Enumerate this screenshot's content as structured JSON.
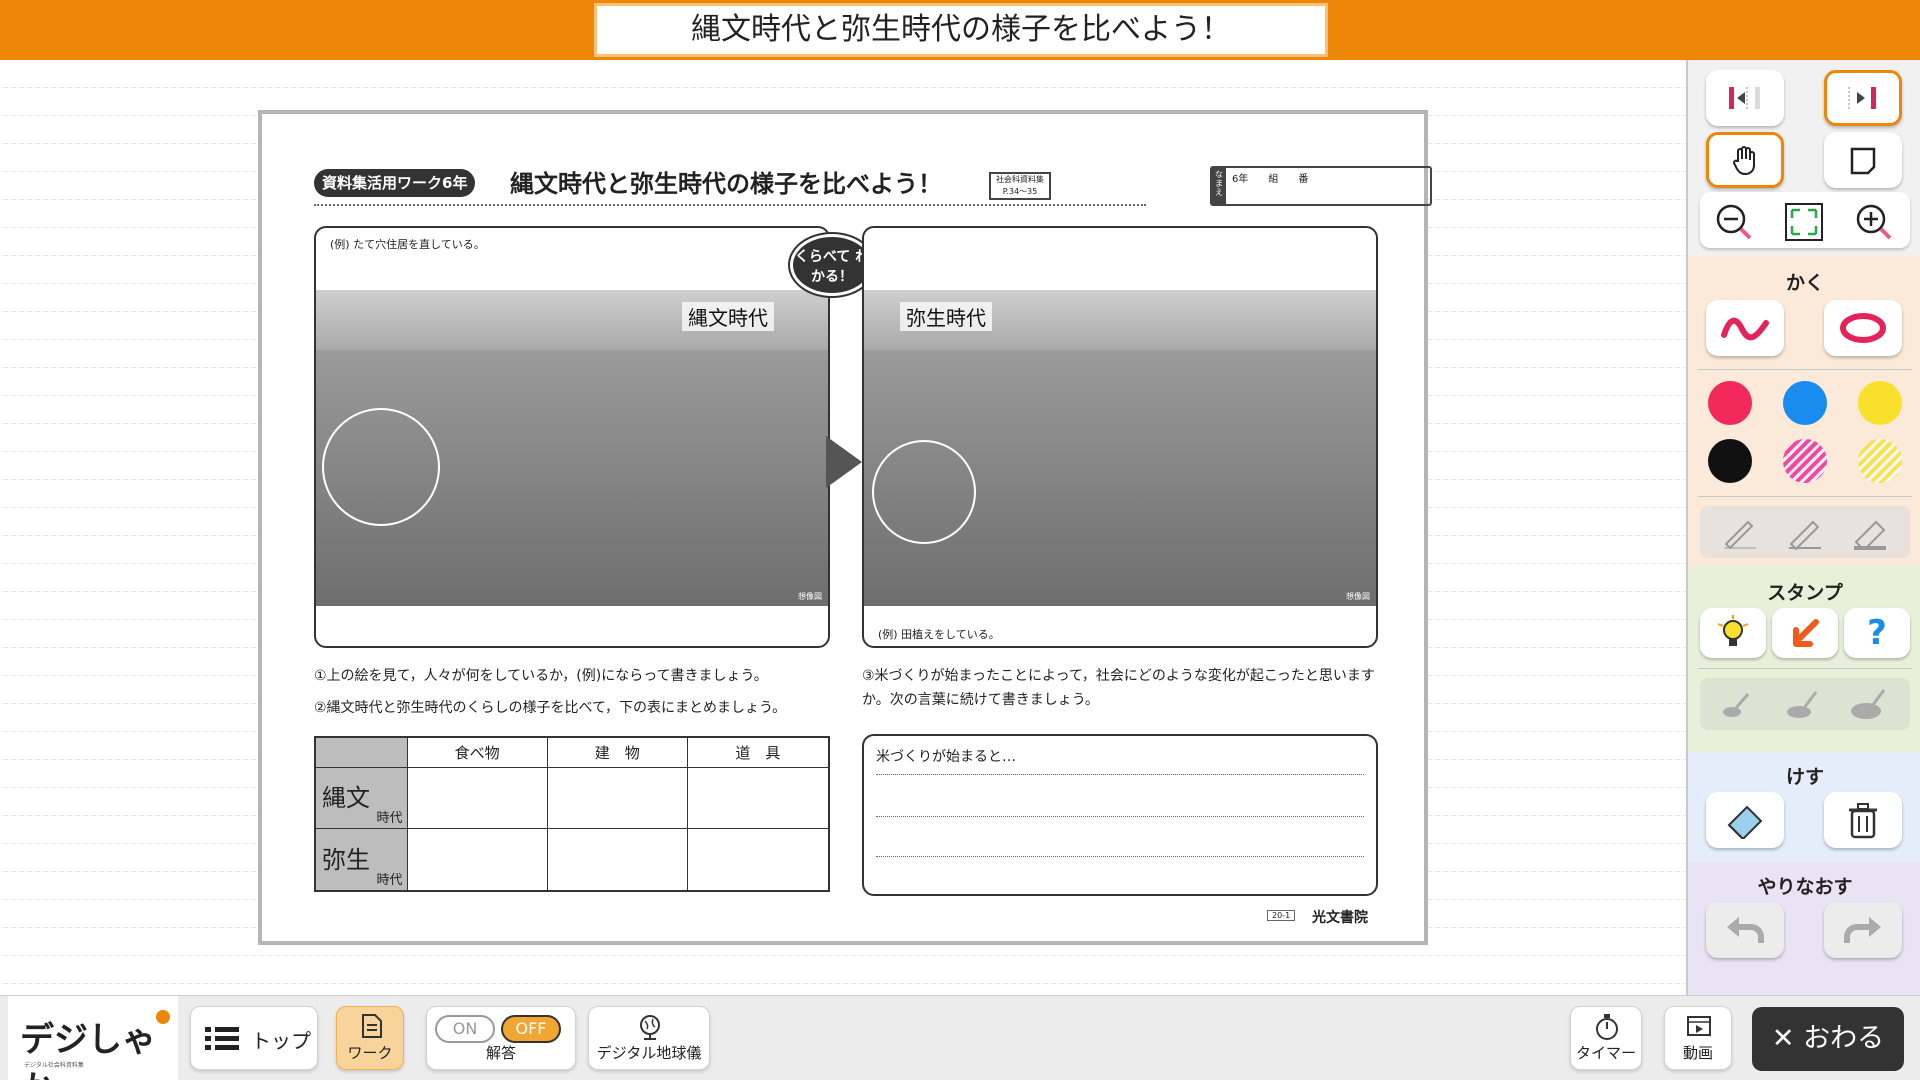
{
  "header": {
    "title": "縄文時代と弥生時代の様子を比べよう！"
  },
  "worksheet": {
    "badge": "資料集活用ワーク6年",
    "title": "縄文時代と弥生時代の様子を比べよう！",
    "ref_box": "社会科資料集 P.34〜35",
    "name_label": "なまえ",
    "name_fields": "6年　　組　　番",
    "compare_bubble": "くらべて わかる！",
    "left_panel": {
      "example": "(例) たて穴住居を直している。",
      "era": "縄文時代",
      "mark": "想像図"
    },
    "right_panel": {
      "example": "(例) 田植えをしている。",
      "era": "弥生時代",
      "mark": "想像図"
    },
    "questions": {
      "q1": "①上の絵を見て，人々が何をしているか，(例)にならって書きましょう。",
      "q2": "②縄文時代と弥生時代のくらしの様子を比べて，下の表にまとめましょう。",
      "q3": "③米づくりが始まったことによって，社会にどのような変化が起こったと思いますか。次の言葉に続けて書きましょう。"
    },
    "table": {
      "columns": [
        "食べ物",
        "建　物",
        "道　具"
      ],
      "rows": [
        {
          "big": "縄文",
          "small": "時代"
        },
        {
          "big": "弥生",
          "small": "時代"
        }
      ]
    },
    "answer_prompt": "米づくりが始まると…",
    "page_code": "20-1",
    "publisher": "光文書院"
  },
  "sidebar": {
    "sections": {
      "draw": "かく",
      "stamp": "スタンプ",
      "erase": "けす",
      "redo": "やりなおす"
    },
    "colors": [
      "#f2295b",
      "#1a8bef",
      "#f9e02b",
      "#111111",
      "#f0499d",
      "#f8e05a"
    ]
  },
  "bottom": {
    "logo": "デジしゃか",
    "logo_sub": "デジタル社会科資料集",
    "top_label": "トップ",
    "work_label": "ワーク",
    "toggle_on": "ON",
    "toggle_off": "OFF",
    "answer_label": "解答",
    "globe_label": "デジタル地球儀",
    "timer_label": "タイマー",
    "video_label": "動画",
    "close_label": "✕ おわる"
  }
}
